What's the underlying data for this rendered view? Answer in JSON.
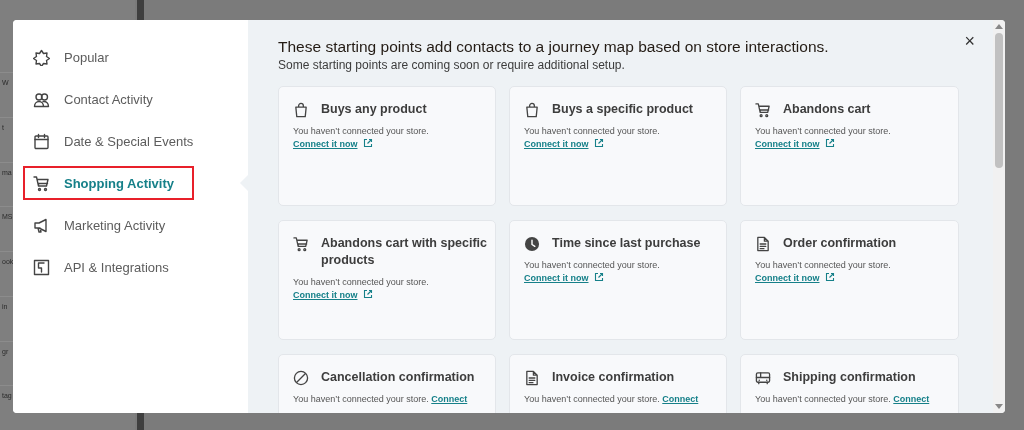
{
  "background_page": {
    "fragments": [
      "W",
      "t",
      "ma",
      "MS",
      "ook",
      "in",
      "gr",
      "tag"
    ]
  },
  "dialog": {
    "close": "×",
    "sidebar": {
      "items": [
        {
          "label": "Popular",
          "kind": "star",
          "selected": false
        },
        {
          "label": "Contact Activity",
          "kind": "people",
          "selected": false
        },
        {
          "label": "Date & Special Events",
          "kind": "calendar",
          "selected": false
        },
        {
          "label": "Shopping Activity",
          "kind": "cart",
          "selected": true
        },
        {
          "label": "Marketing Activity",
          "kind": "megaphone",
          "selected": false
        },
        {
          "label": "API & Integrations",
          "kind": "api",
          "selected": false
        }
      ]
    },
    "heading": "These starting points add contacts to a journey map based on store interactions.",
    "subheading": "Some starting points are coming soon or require additional setup.",
    "cards": [
      {
        "title": "Buys any product",
        "kind": "bag",
        "message": "You haven’t connected your store.",
        "link": "Connect it now"
      },
      {
        "title": "Buys a specific product",
        "kind": "bag",
        "message": "You haven’t connected your store.",
        "link": "Connect it now"
      },
      {
        "title": "Abandons cart",
        "kind": "cart",
        "message": "You haven’t connected your store.",
        "link": "Connect it now"
      },
      {
        "title": "Abandons cart with specific products",
        "kind": "cart",
        "message": "You haven’t connected your store.",
        "link": "Connect it now"
      },
      {
        "title": "Time since last purchase",
        "kind": "clock",
        "message": "You haven’t connected your store.",
        "link": "Connect it now"
      },
      {
        "title": "Order confirmation",
        "kind": "document",
        "message": "You haven’t connected your store.",
        "link": "Connect it now"
      },
      {
        "title": "Cancellation confirmation",
        "kind": "cancel",
        "message": "You haven’t connected your store.",
        "link": "Connect"
      },
      {
        "title": "Invoice confirmation",
        "kind": "document",
        "message": "You haven’t connected your store.",
        "link": "Connect"
      },
      {
        "title": "Shipping confirmation",
        "kind": "truck",
        "message": "You haven’t connected your store.",
        "link": "Connect"
      }
    ]
  }
}
